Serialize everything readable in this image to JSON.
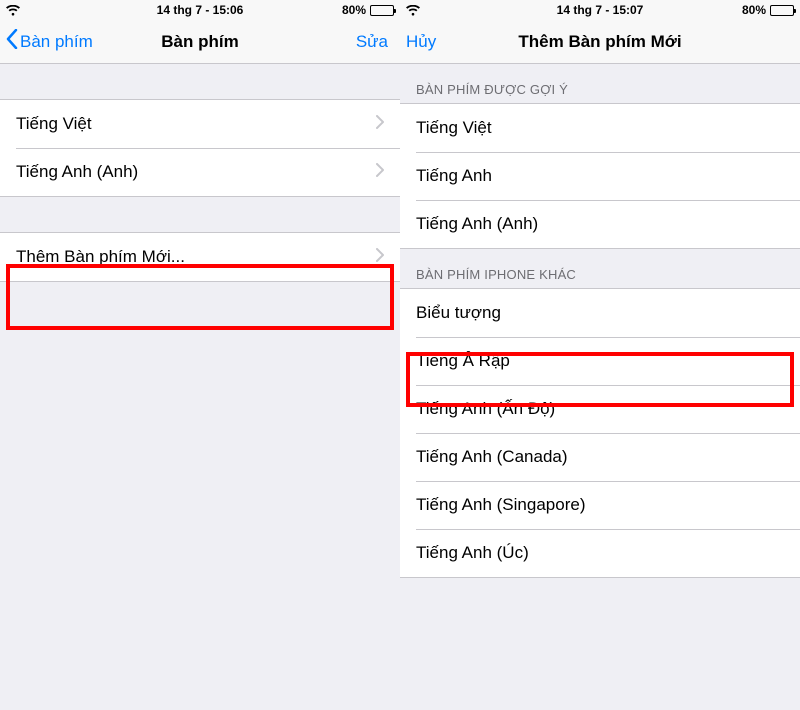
{
  "left": {
    "status": {
      "time": "14 thg 7 - 15:06",
      "battery": "80%"
    },
    "nav": {
      "back": "Bàn phím",
      "title": "Bàn phím",
      "edit": "Sửa"
    },
    "keyboards": [
      {
        "label": "Tiếng Việt"
      },
      {
        "label": "Tiếng Anh (Anh)"
      }
    ],
    "addNew": "Thêm Bàn phím Mới..."
  },
  "right": {
    "status": {
      "time": "14 thg 7 - 15:07",
      "battery": "80%"
    },
    "nav": {
      "cancel": "Hủy",
      "title": "Thêm Bàn phím Mới"
    },
    "suggestedHeader": "BÀN PHÍM ĐƯỢC GỢI Ý",
    "suggested": [
      {
        "label": "Tiếng Việt"
      },
      {
        "label": "Tiếng Anh"
      },
      {
        "label": "Tiếng Anh (Anh)"
      }
    ],
    "otherHeader": "BÀN PHÍM IPHONE KHÁC",
    "other": [
      {
        "label": "Biểu tượng"
      },
      {
        "label": "Tiếng Ả Rập"
      },
      {
        "label": "Tiếng Anh (Ấn Độ)"
      },
      {
        "label": "Tiếng Anh (Canada)"
      },
      {
        "label": "Tiếng Anh (Singapore)"
      },
      {
        "label": "Tiếng Anh (Úc)"
      }
    ]
  }
}
